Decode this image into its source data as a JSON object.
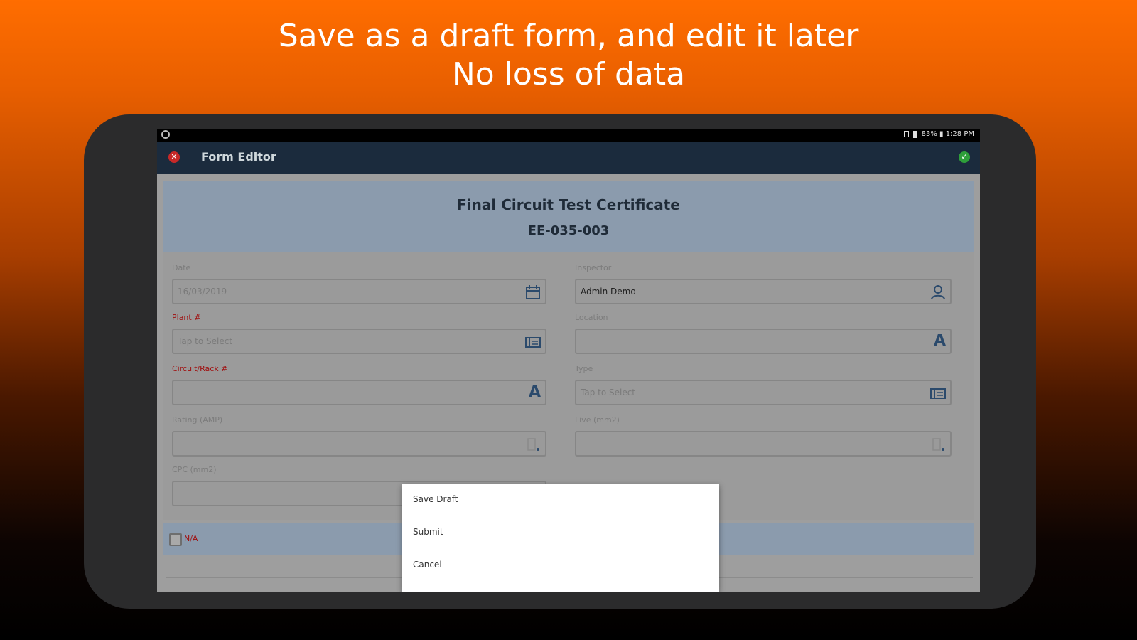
{
  "headline": {
    "line1": "Save as a draft form, and edit it later",
    "line2": "No loss of data"
  },
  "status_bar": {
    "right_text": "83% ▮ 1:28 PM"
  },
  "app_bar": {
    "title": "Form Editor",
    "close_icon": "close-icon",
    "confirm_icon": "check-icon",
    "close_color": "#c62828",
    "confirm_color": "#2e9e3a"
  },
  "form": {
    "title": "Final Circuit Test Certificate",
    "code": "EE-035-003",
    "fields": {
      "date": {
        "label": "Date",
        "value": "16/03/2019",
        "icon": "calendar-icon"
      },
      "inspector": {
        "label": "Inspector",
        "value": "Admin Demo",
        "icon": "person-icon"
      },
      "plant": {
        "label": "Plant #",
        "placeholder": "Tap to Select",
        "icon": "list-select-icon"
      },
      "location": {
        "label": "Location",
        "value": "",
        "icon": "text-icon"
      },
      "circuit_rack": {
        "label": "Circuit/Rack #",
        "value": "",
        "icon": "text-icon"
      },
      "type": {
        "label": "Type",
        "placeholder": "Tap to Select",
        "icon": "list-select-icon"
      },
      "rating": {
        "label": "Rating (AMP)",
        "value": "",
        "icon": "number-icon"
      },
      "live": {
        "label": "Live (mm2)",
        "value": "",
        "icon": "number-icon"
      },
      "cpc": {
        "label": "CPC (mm2)",
        "value": ""
      }
    },
    "na_label": "N/A"
  },
  "text_icon_glyph": "A",
  "popup_menu": {
    "items": [
      "Save Draft",
      "Submit",
      "Cancel"
    ]
  },
  "colors": {
    "app_bar": "#1b2b3d",
    "header_band": "#8b9bad",
    "required_label": "#a01010"
  }
}
